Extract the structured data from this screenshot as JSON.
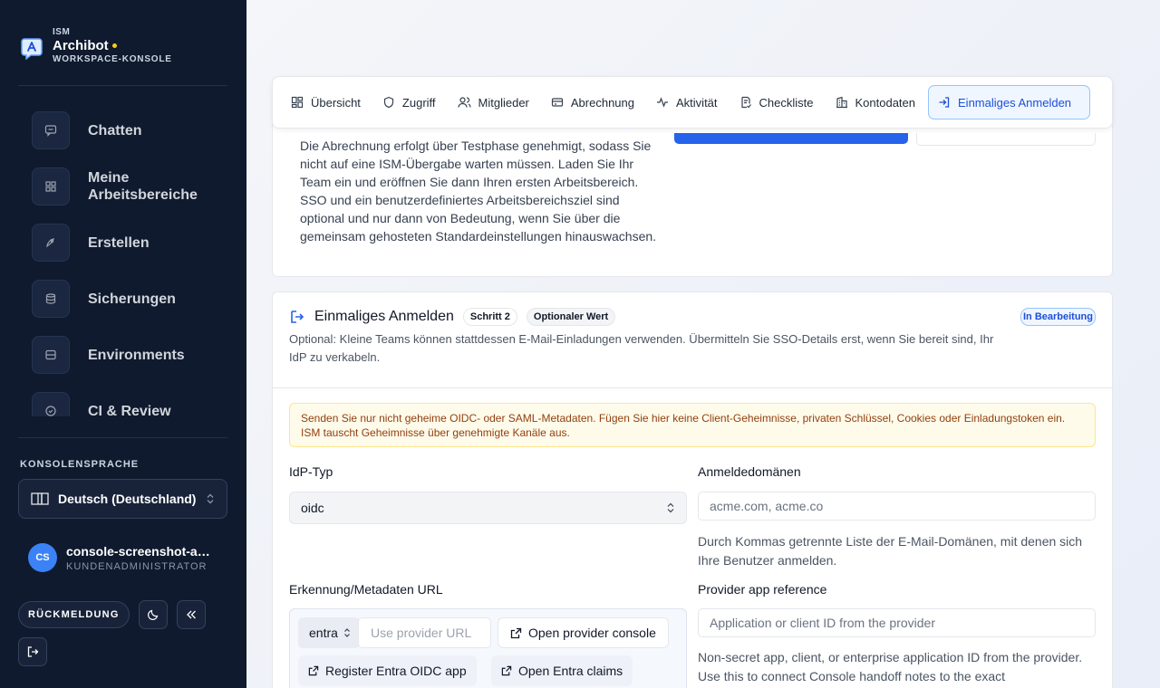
{
  "brand": {
    "eyebrow": "ISM",
    "name": "Archibot",
    "subtitle": "WORKSPACE-KONSOLE"
  },
  "nav": [
    {
      "label": "Chatten",
      "icon": "chat-icon"
    },
    {
      "label": "Meine Arbeitsbereiche",
      "icon": "grid-icon"
    },
    {
      "label": "Erstellen",
      "icon": "rocket-icon"
    },
    {
      "label": "Sicherungen",
      "icon": "database-icon"
    },
    {
      "label": "Environments",
      "icon": "server-icon"
    },
    {
      "label": "CI & Review",
      "icon": "check-circle-icon"
    }
  ],
  "language": {
    "label": "KONSOLENSPRACHE",
    "value": "Deutsch (Deutschland)"
  },
  "user": {
    "initials": "CS",
    "name": "console-screenshot-admin",
    "role": "KUNDENADMINISTRATOR"
  },
  "footer": {
    "feedback": "RÜCKMELDUNG"
  },
  "tabs": [
    {
      "label": "Übersicht",
      "icon": "grid-icon"
    },
    {
      "label": "Zugriff",
      "icon": "shield-icon"
    },
    {
      "label": "Mitglieder",
      "icon": "users-icon"
    },
    {
      "label": "Abrechnung",
      "icon": "card-icon"
    },
    {
      "label": "Aktivität",
      "icon": "activity-icon"
    },
    {
      "label": "Checkliste",
      "icon": "checklist-icon"
    },
    {
      "label": "Kontodaten",
      "icon": "building-icon"
    },
    {
      "label": "Einmaliges Anmelden",
      "icon": "login-icon",
      "active": true
    }
  ],
  "intro": {
    "text": "Die Abrechnung erfolgt über Testphase genehmigt, sodass Sie nicht auf eine ISM-Übergabe warten müssen. Laden Sie Ihr Team ein und eröffnen Sie dann Ihren ersten Arbeitsbereich. SSO und ein benutzerdefiniertes Arbeitsbereichsziel sind optional und nur dann von Bedeutung, wenn Sie über die gemeinsam gehosteten Standardeinstellungen hinauswachsen."
  },
  "sso": {
    "title": "Einmaliges Anmelden",
    "step": "Schritt 2",
    "optional": "Optionaler Wert",
    "status": "In Bearbeitung",
    "description": "Optional: Kleine Teams können stattdessen E-Mail-Einladungen verwenden. Übermitteln Sie SSO-Details erst, wenn Sie bereit sind, Ihr IdP zu verkabeln.",
    "warning": "Senden Sie nur nicht geheime OIDC- oder SAML-Metadaten. Fügen Sie hier keine Client-Geheimnisse, privaten Schlüssel, Cookies oder Einladungstoken ein. ISM tauscht Geheimnisse über genehmigte Kanäle aus.",
    "idp_label": "IdP-Typ",
    "idp_value": "oidc",
    "domains_label": "Anmeldedomänen",
    "domains_placeholder": "acme.com, acme.co",
    "domains_help": "Durch Kommas getrennte Liste der E-Mail-Domänen, mit denen sich Ihre Benutzer anmelden.",
    "url_label": "Erkennung/Metadaten URL",
    "provider_value": "entra",
    "url_placeholder": "Use provider URL",
    "open_console": "Open provider console",
    "register_app": "Register Entra OIDC app",
    "open_claims": "Open Entra claims",
    "app_ref_label": "Provider app reference",
    "app_ref_placeholder": "Application or client ID from the provider",
    "app_ref_help": "Non-secret app, client, or enterprise application ID from the provider. Use this to connect Console handoff notes to the exact"
  }
}
